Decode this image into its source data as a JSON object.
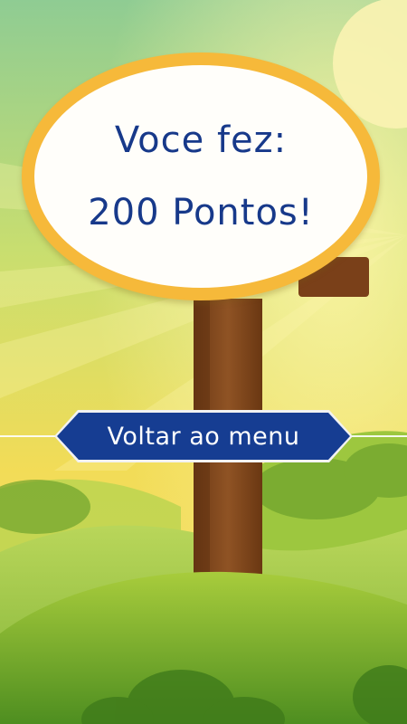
{
  "result": {
    "line1": "Voce fez:",
    "line2": "200 Pontos!"
  },
  "menu_button": {
    "label": "Voltar ao menu"
  },
  "colors": {
    "text_blue": "#17398a",
    "sign_border": "#f6b93a",
    "button_fill": "#163d92",
    "sky_top": "#9fcf8e",
    "sky_bottom": "#f3dc59",
    "grass": "#8fbf3c",
    "post_wood": "#8a4e21"
  }
}
